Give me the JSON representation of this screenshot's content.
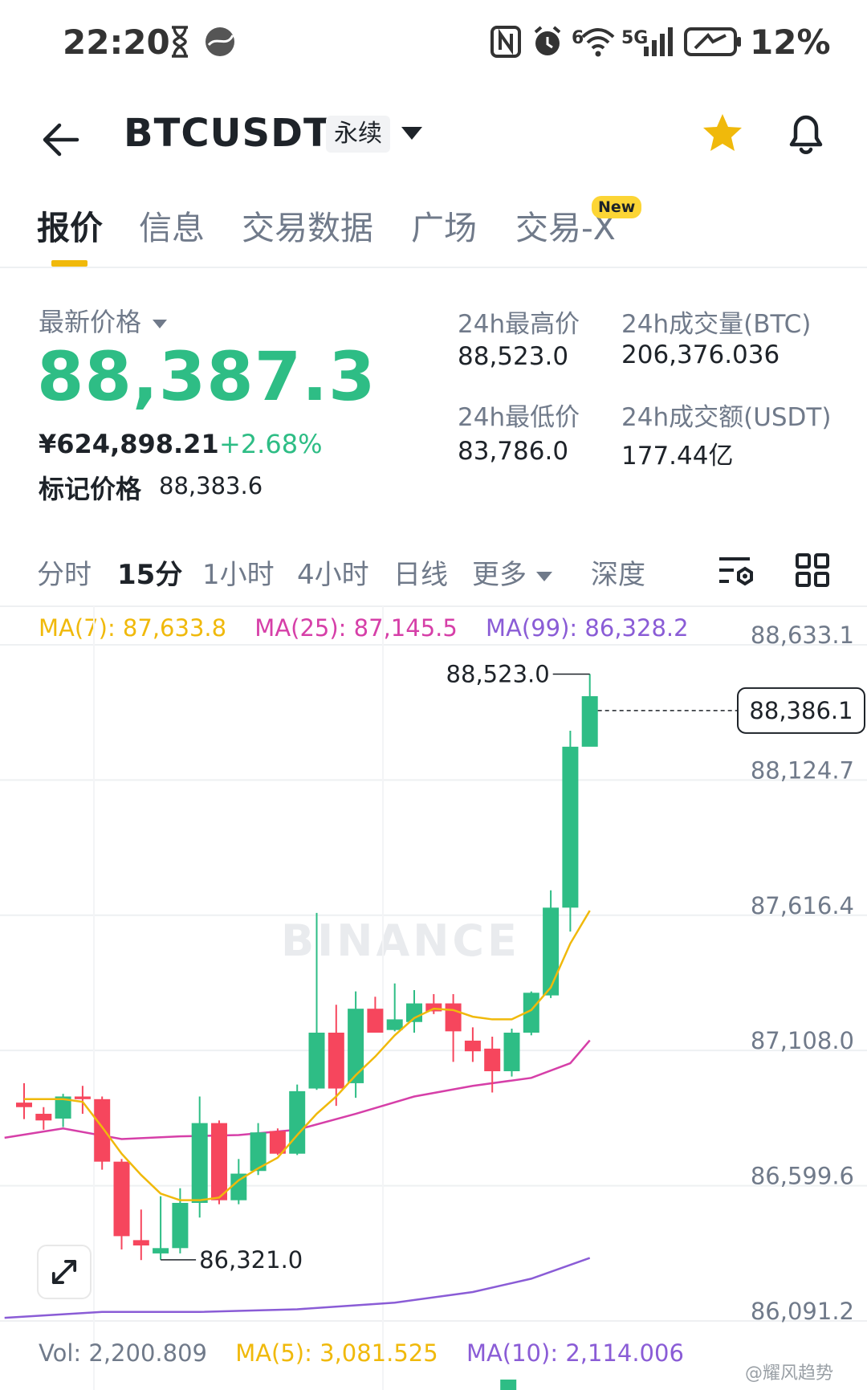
{
  "status_bar": {
    "time": "22:20",
    "battery": "12%",
    "network": "5G",
    "wifi_badge": "6",
    "icons": [
      "hourglass-icon",
      "globe-icon",
      "nfc-icon",
      "alarm-icon",
      "wifi-icon",
      "signal-icon",
      "battery-charging-icon"
    ]
  },
  "header": {
    "symbol": "BTCUSDT",
    "contract_type": "永续",
    "icons": [
      "back-arrow-icon",
      "dropdown-icon",
      "star-icon",
      "bell-icon"
    ],
    "favorite_color": "#f0b90b"
  },
  "tabs": [
    {
      "label": "报价",
      "active": true
    },
    {
      "label": "信息",
      "active": false
    },
    {
      "label": "交易数据",
      "active": false
    },
    {
      "label": "广场",
      "active": false
    },
    {
      "label": "交易-X",
      "active": false,
      "badge": "New"
    }
  ],
  "price": {
    "last_price_label": "最新价格",
    "last_price": "88,387.3",
    "cny_price": "¥624,898.21",
    "change_pct": "+2.68%",
    "mark_price_label": "标记价格",
    "mark_price": "88,383.6",
    "up_color": "#2ebd85",
    "down_color": "#f6465d"
  },
  "stats": {
    "high_label": "24h最高价",
    "high": "88,523.0",
    "low_label": "24h最低价",
    "low": "83,786.0",
    "vol_btc_label": "24h成交量(BTC)",
    "vol_btc": "206,376.036",
    "vol_usdt_label": "24h成交额(USDT)",
    "vol_usdt": "177.44亿"
  },
  "intervals": [
    {
      "label": "分时",
      "active": false
    },
    {
      "label": "15分",
      "active": true
    },
    {
      "label": "1小时",
      "active": false
    },
    {
      "label": "4小时",
      "active": false
    },
    {
      "label": "日线",
      "active": false
    },
    {
      "label": "更多",
      "active": false,
      "dropdown": true
    },
    {
      "label": "深度",
      "active": false
    }
  ],
  "interval_icons": [
    "chart-settings-icon",
    "grid-layout-icon"
  ],
  "ma_legend": {
    "ma7": "MA(7): 87,633.8",
    "ma25": "MA(25): 87,145.5",
    "ma99": "MA(99): 86,328.2",
    "ma7_color": "#f0b90b",
    "ma25_color": "#d63fa8",
    "ma99_color": "#8a5cd6"
  },
  "vol_legend": {
    "vol": "Vol: 2,200.809",
    "ma5": "MA(5): 3,081.525",
    "ma10": "MA(10): 2,114.006"
  },
  "watermark": "BINANCE",
  "corner_watermark": "@耀风趋势",
  "chart_data": {
    "type": "candlestick",
    "interval": "15分",
    "y_ticks": [
      "88,633.1",
      "88,124.7",
      "87,616.4",
      "87,108.0",
      "86,599.6",
      "86,091.2"
    ],
    "y_tick_values": [
      88633.1,
      88124.7,
      87616.4,
      87108.0,
      86599.6,
      86091.2
    ],
    "ylim": [
      86091.2,
      88633.1
    ],
    "current_price_label": "88,386.1",
    "current_price": 88386.1,
    "high_annotation": "88,523.0",
    "high_value": 88523.0,
    "low_annotation": "86,321.0",
    "low_value": 86321.0,
    "candles": [
      {
        "o": 86912,
        "h": 86985,
        "l": 86850,
        "c": 86895
      },
      {
        "o": 86870,
        "h": 86895,
        "l": 86810,
        "c": 86845
      },
      {
        "o": 86852,
        "h": 86945,
        "l": 86820,
        "c": 86935
      },
      {
        "o": 86935,
        "h": 86975,
        "l": 86870,
        "c": 86925
      },
      {
        "o": 86925,
        "h": 86935,
        "l": 86660,
        "c": 86690
      },
      {
        "o": 86690,
        "h": 86700,
        "l": 86360,
        "c": 86410
      },
      {
        "o": 86395,
        "h": 86510,
        "l": 86320,
        "c": 86375
      },
      {
        "o": 86345,
        "h": 86560,
        "l": 86321,
        "c": 86365
      },
      {
        "o": 86365,
        "h": 86590,
        "l": 86345,
        "c": 86535
      },
      {
        "o": 86535,
        "h": 86935,
        "l": 86480,
        "c": 86835
      },
      {
        "o": 86835,
        "h": 86845,
        "l": 86530,
        "c": 86545
      },
      {
        "o": 86545,
        "h": 86700,
        "l": 86530,
        "c": 86645
      },
      {
        "o": 86655,
        "h": 86835,
        "l": 86640,
        "c": 86800
      },
      {
        "o": 86805,
        "h": 86815,
        "l": 86715,
        "c": 86720
      },
      {
        "o": 86720,
        "h": 86980,
        "l": 86715,
        "c": 86955
      },
      {
        "o": 86965,
        "h": 87625,
        "l": 86960,
        "c": 87175
      },
      {
        "o": 87175,
        "h": 87280,
        "l": 86900,
        "c": 86965
      },
      {
        "o": 86985,
        "h": 87330,
        "l": 86930,
        "c": 87265
      },
      {
        "o": 87265,
        "h": 87310,
        "l": 87175,
        "c": 87175
      },
      {
        "o": 87185,
        "h": 87360,
        "l": 87180,
        "c": 87225
      },
      {
        "o": 87215,
        "h": 87335,
        "l": 87175,
        "c": 87285
      },
      {
        "o": 87285,
        "h": 87320,
        "l": 87245,
        "c": 87255
      },
      {
        "o": 87285,
        "h": 87320,
        "l": 87065,
        "c": 87180
      },
      {
        "o": 87145,
        "h": 87195,
        "l": 87065,
        "c": 87105
      },
      {
        "o": 87115,
        "h": 87160,
        "l": 86950,
        "c": 87030
      },
      {
        "o": 87030,
        "h": 87190,
        "l": 87010,
        "c": 87175
      },
      {
        "o": 87175,
        "h": 87330,
        "l": 87165,
        "c": 87325
      },
      {
        "o": 87315,
        "h": 87710,
        "l": 87305,
        "c": 87645
      },
      {
        "o": 87645,
        "h": 88310,
        "l": 87555,
        "c": 88250
      },
      {
        "o": 88250,
        "h": 88523,
        "l": 88350,
        "c": 88440
      }
    ],
    "ma7": [
      {
        "i": 0,
        "v": 86925
      },
      {
        "i": 1,
        "v": 86925
      },
      {
        "i": 2,
        "v": 86925
      },
      {
        "i": 3,
        "v": 86915
      },
      {
        "i": 4,
        "v": 86820
      },
      {
        "i": 5,
        "v": 86720
      },
      {
        "i": 6,
        "v": 86640
      },
      {
        "i": 7,
        "v": 86570
      },
      {
        "i": 8,
        "v": 86545
      },
      {
        "i": 9,
        "v": 86545
      },
      {
        "i": 10,
        "v": 86555
      },
      {
        "i": 11,
        "v": 86620
      },
      {
        "i": 12,
        "v": 86665
      },
      {
        "i": 13,
        "v": 86705
      },
      {
        "i": 14,
        "v": 86790
      },
      {
        "i": 15,
        "v": 86870
      },
      {
        "i": 16,
        "v": 86935
      },
      {
        "i": 17,
        "v": 87015
      },
      {
        "i": 18,
        "v": 87085
      },
      {
        "i": 19,
        "v": 87165
      },
      {
        "i": 20,
        "v": 87230
      },
      {
        "i": 21,
        "v": 87265
      },
      {
        "i": 22,
        "v": 87260
      },
      {
        "i": 23,
        "v": 87235
      },
      {
        "i": 24,
        "v": 87225
      },
      {
        "i": 25,
        "v": 87225
      },
      {
        "i": 26,
        "v": 87260
      },
      {
        "i": 27,
        "v": 87345
      },
      {
        "i": 28,
        "v": 87510
      },
      {
        "i": 29,
        "v": 87634
      }
    ],
    "ma25": [
      {
        "i": -1,
        "v": 86780
      },
      {
        "i": 2,
        "v": 86815
      },
      {
        "i": 5,
        "v": 86775
      },
      {
        "i": 8,
        "v": 86785
      },
      {
        "i": 11,
        "v": 86790
      },
      {
        "i": 14,
        "v": 86810
      },
      {
        "i": 17,
        "v": 86870
      },
      {
        "i": 20,
        "v": 86935
      },
      {
        "i": 23,
        "v": 86975
      },
      {
        "i": 26,
        "v": 87005
      },
      {
        "i": 28,
        "v": 87060
      },
      {
        "i": 29,
        "v": 87146
      }
    ],
    "ma99": [
      {
        "i": -1,
        "v": 86103
      },
      {
        "i": 4,
        "v": 86125
      },
      {
        "i": 9,
        "v": 86125
      },
      {
        "i": 14,
        "v": 86135
      },
      {
        "i": 19,
        "v": 86160
      },
      {
        "i": 23,
        "v": 86200
      },
      {
        "i": 26,
        "v": 86250
      },
      {
        "i": 29,
        "v": 86328
      }
    ],
    "grid": true,
    "axis_position": "right"
  }
}
